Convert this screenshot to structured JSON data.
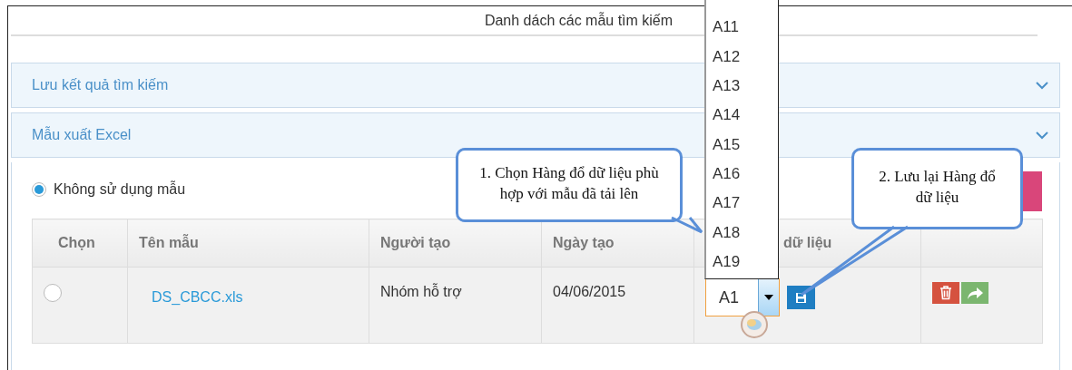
{
  "title": "Danh dách các mẫu tìm kiếm",
  "panels": [
    {
      "title": "Lưu kết quả tìm kiếm"
    },
    {
      "title": "Mẫu xuất Excel"
    }
  ],
  "template_option": {
    "label": "Không sử dụng mẫu",
    "selected": true
  },
  "table": {
    "columns": [
      "Chọn",
      "Tên mẫu",
      "Người tạo",
      "Ngày tạo",
      "dữ liệu"
    ],
    "rows": [
      {
        "selected": false,
        "name": "DS_CBCC.xls",
        "creator": "Nhóm hỗ trợ",
        "created": "04/06/2015",
        "data_row": "A1"
      }
    ]
  },
  "dropdown": {
    "options": [
      "A11",
      "A12",
      "A13",
      "A14",
      "A15",
      "A16",
      "A17",
      "A18",
      "A19"
    ]
  },
  "callouts": [
    "1. Chọn Hàng đổ dữ liệu phù hợp với mẫu đã tải lên",
    "2. Lưu lại Hàng đổ dữ liệu"
  ]
}
